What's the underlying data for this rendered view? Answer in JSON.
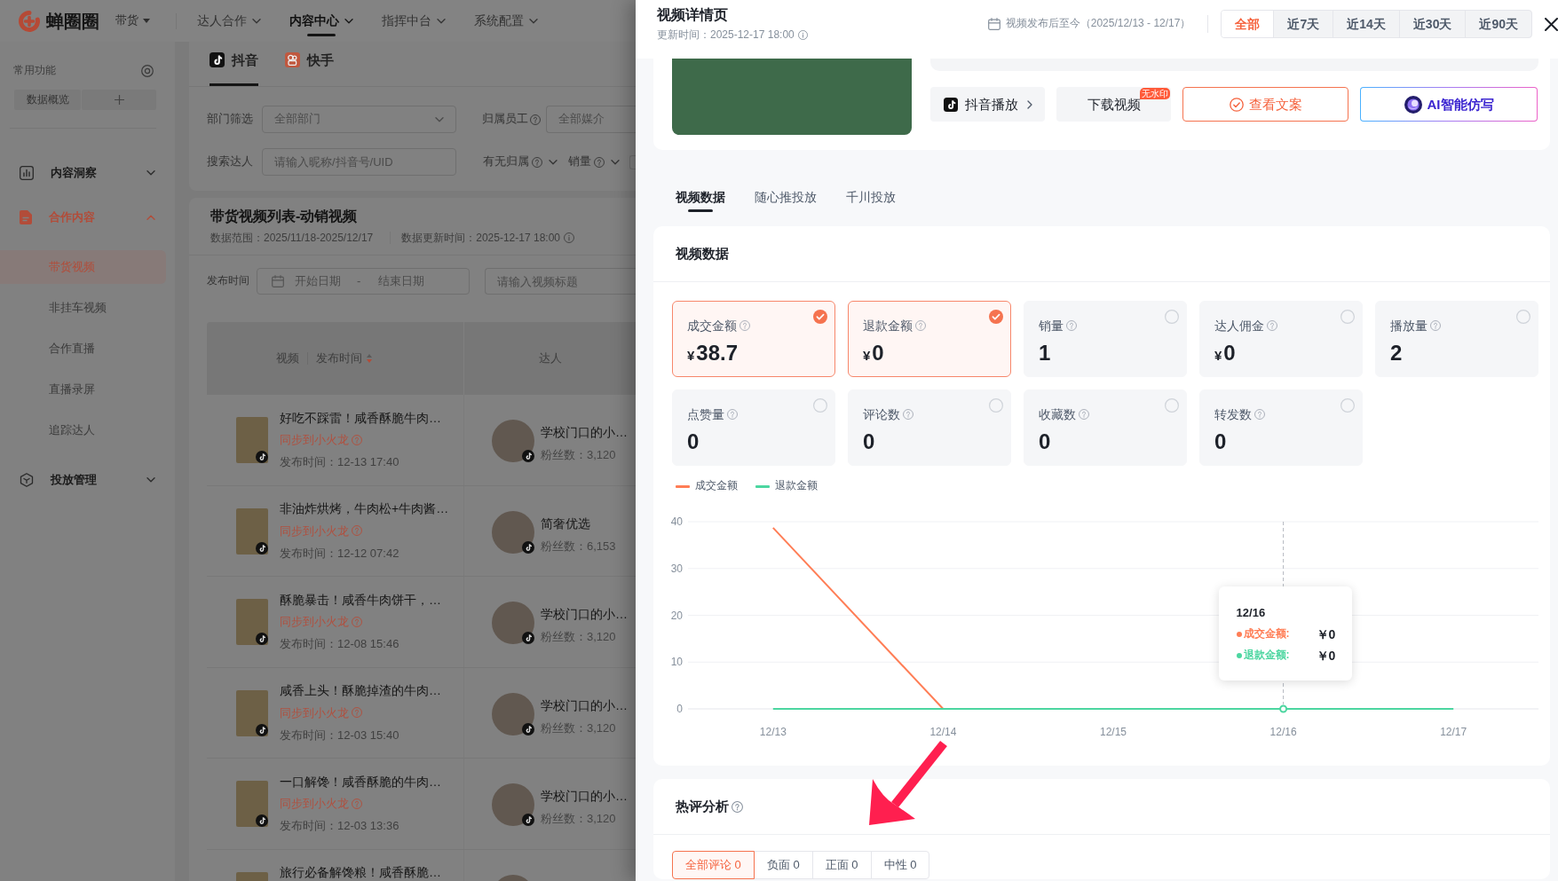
{
  "top_nav": {
    "logo_text": "蝉圈圈",
    "scope": "带货",
    "items": [
      {
        "label": "达人合作",
        "selected": false
      },
      {
        "label": "内容中心",
        "selected": true
      },
      {
        "label": "指挥中台",
        "selected": false
      },
      {
        "label": "系统配置",
        "selected": false
      }
    ]
  },
  "sidebar": {
    "shortcuts_title": "常用功能",
    "shortcuts": [
      {
        "label": "数据概览"
      }
    ],
    "groups": [
      {
        "label": "内容洞察",
        "selected": false,
        "expanded": false
      },
      {
        "label": "合作内容",
        "selected": true,
        "expanded": true,
        "children": [
          {
            "label": "带货视频",
            "selected": true
          },
          {
            "label": "非挂车视频",
            "selected": false
          },
          {
            "label": "合作直播",
            "selected": false
          },
          {
            "label": "直播录屏",
            "selected": false
          },
          {
            "label": "追踪达人",
            "selected": false
          }
        ]
      },
      {
        "label": "投放管理",
        "selected": false,
        "expanded": false
      }
    ]
  },
  "platform_tabs": [
    {
      "label": "抖音",
      "selected": true
    },
    {
      "label": "快手",
      "selected": false
    }
  ],
  "filter_rows": [
    {
      "items": [
        {
          "kind": "select",
          "label": "部门筛选",
          "placeholder": "全部部门"
        },
        {
          "kind": "select",
          "label": "归属员工",
          "help": true,
          "placeholder": "全部媒介"
        }
      ]
    },
    {
      "items": [
        {
          "kind": "input",
          "label": "搜索达人",
          "placeholder": "请输入昵称/抖音号/UID"
        },
        {
          "kind": "dropdown",
          "label": "有无归属",
          "help": true
        },
        {
          "kind": "dropdown",
          "label": "销量",
          "help": true
        },
        {
          "kind": "box"
        }
      ]
    }
  ],
  "video_list": {
    "title": "带货视频列表-动销视频",
    "data_range": "数据范围：2025/11/18-2025/12/17",
    "updated": "数据更新时间：2025-12-17 18:00",
    "publish_filter": {
      "label": "发布时间",
      "start_placeholder": "开始日期",
      "separator": "-",
      "end_placeholder": "结束日期"
    },
    "title_search": {
      "placeholder": "请输入视频标题"
    },
    "columns": [
      {
        "labels": [
          {
            "text": "视频",
            "sortable": false
          },
          {
            "text": "发布时间",
            "sortable": true
          }
        ]
      },
      {
        "labels": [
          {
            "text": "达人",
            "sortable": false
          }
        ]
      }
    ],
    "rows": [
      {
        "title": "好吃不踩雷！咸香酥脆牛肉…",
        "sync": "同步到小火龙",
        "published": "发布时间：12-13 17:40",
        "creator": "学校门口的小…",
        "fans": "粉丝数：3,120"
      },
      {
        "title": "非油炸烘烤，牛肉松+牛肉酱…",
        "sync": "同步到小火龙",
        "published": "发布时间：12-12 07:42",
        "creator": "简奢优选",
        "fans": "粉丝数：6,153"
      },
      {
        "title": "酥脆暴击！咸香牛肉饼干，…",
        "sync": "同步到小火龙",
        "published": "发布时间：12-08 15:46",
        "creator": "学校门口的小…",
        "fans": "粉丝数：3,120"
      },
      {
        "title": "咸香上头！酥脆掉渣的牛肉…",
        "sync": "同步到小火龙",
        "published": "发布时间：12-03 15:40",
        "creator": "学校门口的小…",
        "fans": "粉丝数：3,120"
      },
      {
        "title": "一口解馋！咸香酥脆的牛肉…",
        "sync": "同步到小火龙",
        "published": "发布时间：12-03 13:36",
        "creator": "学校门口的小…",
        "fans": "粉丝数：3,120"
      },
      {
        "title": "旅行必备解馋粮！咸香酥脆…"
      }
    ]
  },
  "detail": {
    "title": "视频详情页",
    "updated": "更新时间：2025-12-17 18:00",
    "date_range": "视频发布后至今（2025/12/13 - 12/17）",
    "ranges": [
      {
        "label": "全部",
        "selected": true
      },
      {
        "label": "近7天",
        "selected": false
      },
      {
        "label": "近14天",
        "selected": false
      },
      {
        "label": "近30天",
        "selected": false
      },
      {
        "label": "近90天",
        "selected": false
      }
    ],
    "actions": [
      {
        "kind": "play",
        "label": "抖音播放"
      },
      {
        "kind": "download",
        "label": "下载视频",
        "badge": "无水印"
      },
      {
        "kind": "copy",
        "label": "查看文案"
      },
      {
        "kind": "ai",
        "label": "AI智能仿写"
      }
    ],
    "tabs": [
      {
        "label": "视频数据",
        "selected": true
      },
      {
        "label": "随心推投放",
        "selected": false
      },
      {
        "label": "千川投放",
        "selected": false
      }
    ],
    "video_data": {
      "title": "视频数据",
      "metrics": [
        {
          "label": "成交金额",
          "currency": "¥",
          "value": "38.7",
          "checked": true
        },
        {
          "label": "退款金额",
          "currency": "¥",
          "value": "0",
          "checked": true
        },
        {
          "label": "销量",
          "value": "1",
          "checked": false
        },
        {
          "label": "达人佣金",
          "currency": "¥",
          "value": "0",
          "checked": false
        },
        {
          "label": "播放量",
          "value": "2",
          "checked": false
        },
        {
          "label": "点赞量",
          "value": "0",
          "checked": false
        },
        {
          "label": "评论数",
          "value": "0",
          "checked": false
        },
        {
          "label": "收藏数",
          "value": "0",
          "checked": false
        },
        {
          "label": "转发数",
          "value": "0",
          "checked": false
        }
      ],
      "chart": {
        "chart_data": {
          "type": "line",
          "categories": [
            "12/13",
            "12/14",
            "12/15",
            "12/16",
            "12/17"
          ],
          "series": [
            {
              "name": "成交金额",
              "color": "#ff7d55",
              "values": [
                38.7,
                0,
                null,
                null,
                null
              ]
            },
            {
              "name": "退款金额",
              "color": "#4cd6a0",
              "values": [
                0,
                0,
                0,
                0,
                0
              ]
            }
          ],
          "ylim": [
            0,
            40
          ],
          "yticks": [
            0,
            10,
            20,
            30,
            40
          ],
          "grid": true,
          "ref_lines": [
            {
              "axis": "x",
              "value": "12/16"
            }
          ]
        },
        "tooltip": {
          "title": "12/16",
          "rows": [
            {
              "label": "成交金额:",
              "value": "￥0"
            },
            {
              "label": "退款金额:",
              "value": "￥0"
            }
          ]
        }
      }
    },
    "hot_comments": {
      "title": "热评分析",
      "filters": [
        {
          "label": "全部评论 0",
          "selected": true
        },
        {
          "label": "负面 0",
          "selected": false
        },
        {
          "label": "正面 0",
          "selected": false
        },
        {
          "label": "中性 0",
          "selected": false
        }
      ]
    }
  }
}
